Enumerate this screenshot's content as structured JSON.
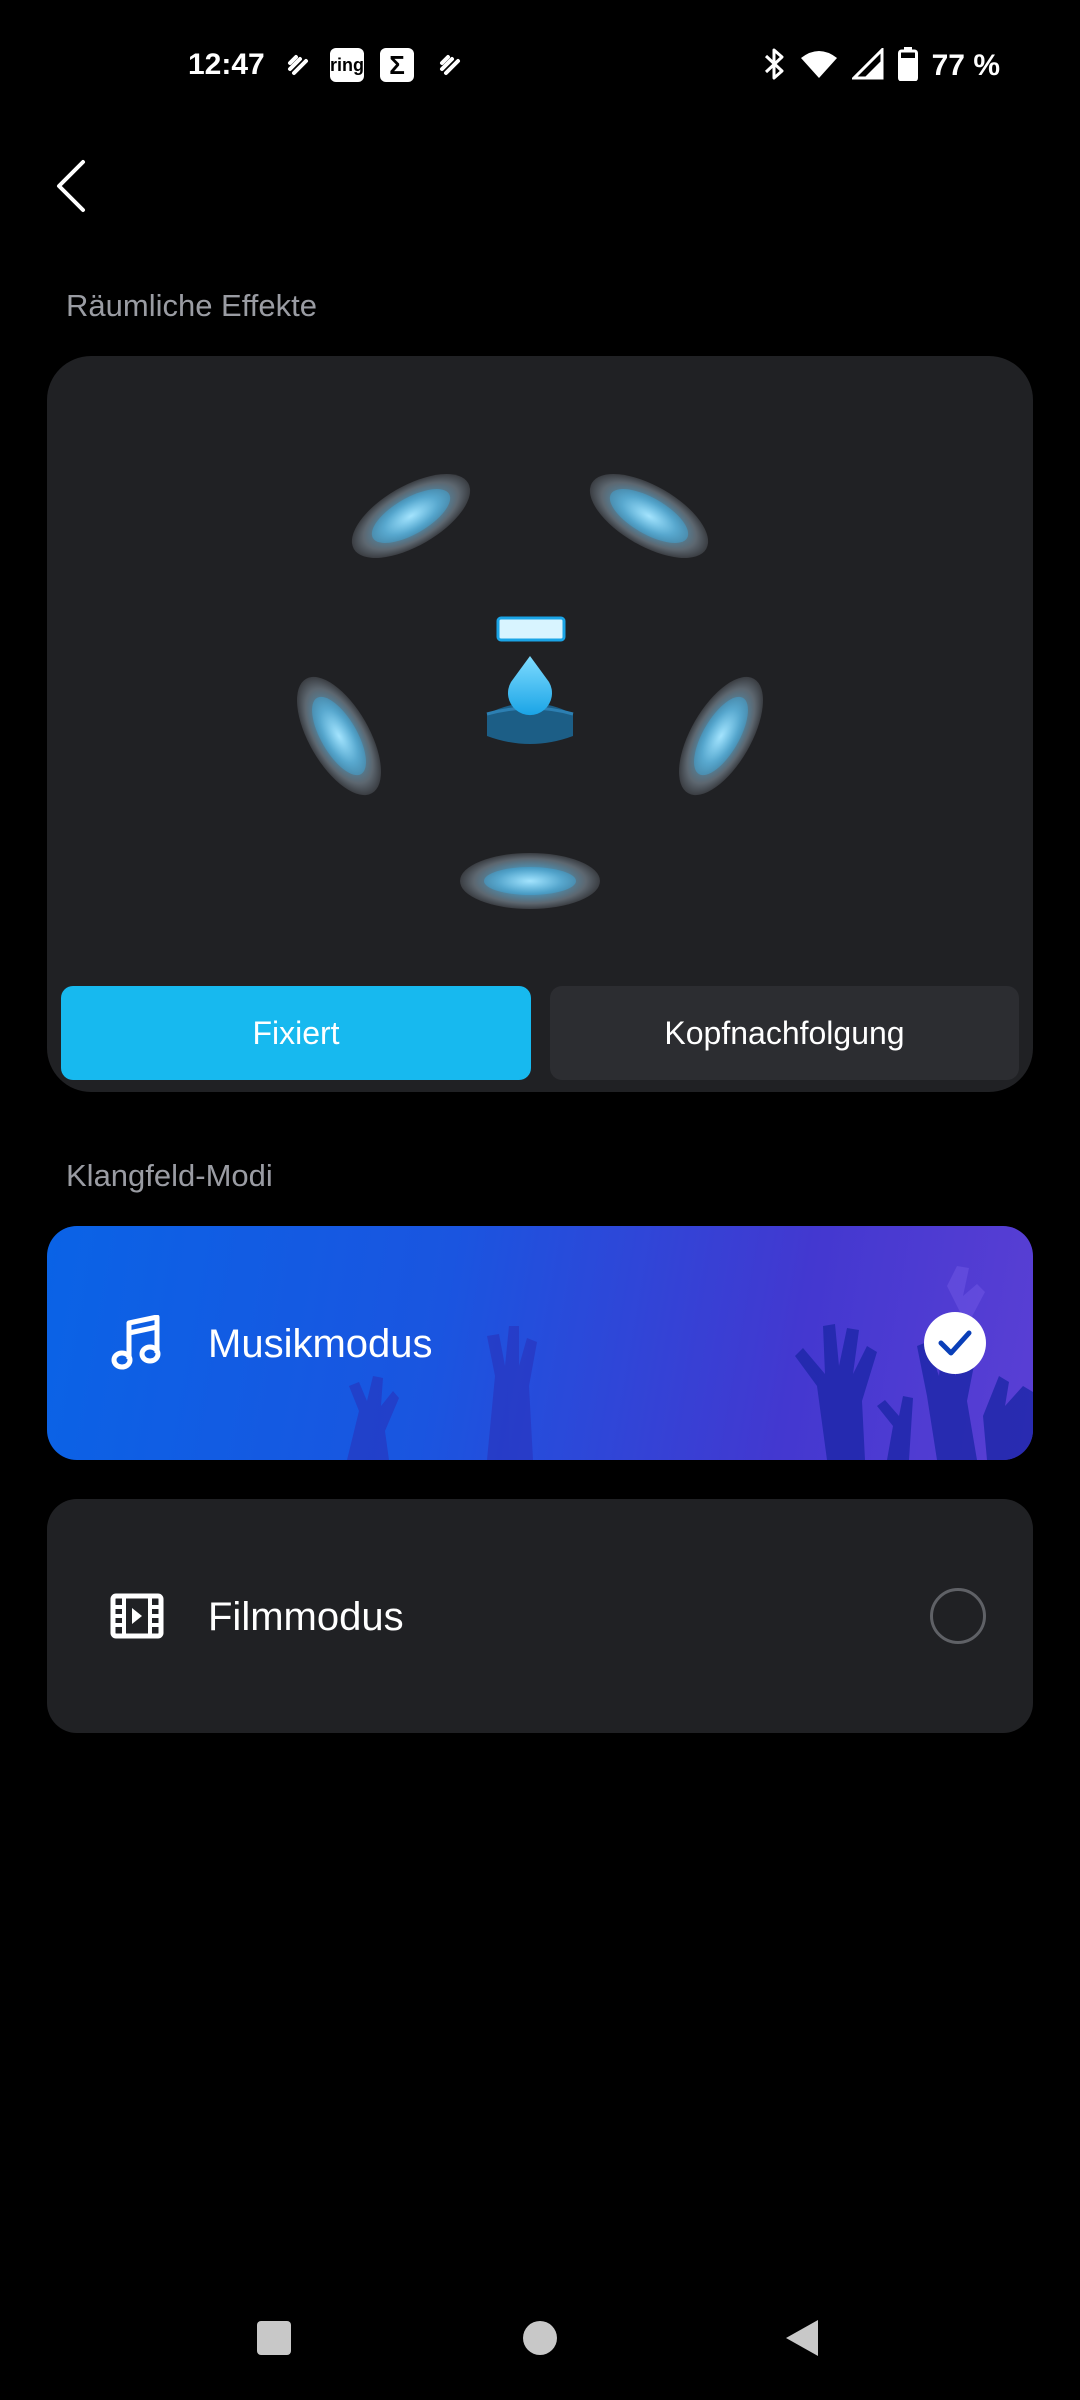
{
  "status_bar": {
    "time": "12:47",
    "app_icons": [
      "heart-link-icon",
      "ring-icon",
      "sigma-icon",
      "heart-link-icon"
    ],
    "ring_label": "ring",
    "sigma_label": "Σ",
    "battery": "77 %"
  },
  "header": {
    "back_icon": "chevron-left-icon"
  },
  "spatial": {
    "section_title": "Räumliche Effekte",
    "options": [
      {
        "label": "Fixiert",
        "selected": true
      },
      {
        "label": "Kopfnachfolgung",
        "selected": false
      }
    ]
  },
  "soundfield": {
    "section_title": "Klangfeld-Modi",
    "modes": [
      {
        "label": "Musikmodus",
        "icon": "music-note-icon",
        "selected": true
      },
      {
        "label": "Filmmodus",
        "icon": "film-icon",
        "selected": false
      }
    ]
  },
  "colors": {
    "accent": "#17b9ef",
    "card": "#202124",
    "music_gradient_start": "#0a63e6",
    "music_gradient_end": "#5a3fd4"
  }
}
